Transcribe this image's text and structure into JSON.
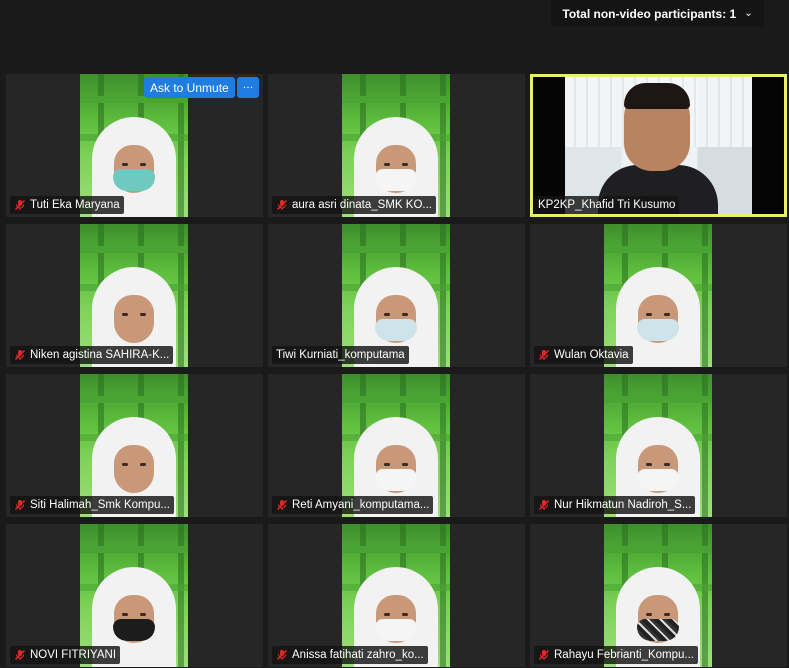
{
  "topbar": {
    "label": "Total non-video participants: 1"
  },
  "ask_to_unmute": "Ask to Unmute",
  "more_options": "···",
  "participants": [
    {
      "name": "Tuti Eka Maryana",
      "muted": true,
      "mask": "teal"
    },
    {
      "name": "aura asri dinata_SMK KO...",
      "muted": true,
      "mask": "white"
    },
    {
      "name": "KP2KP_Khafid Tri Kusumo",
      "muted": false,
      "host": true
    },
    {
      "name": "Niken agistina SAHIRA-K...",
      "muted": true,
      "mask": "none"
    },
    {
      "name": "Tiwi Kurniati_komputama",
      "muted": false,
      "mask": "blue"
    },
    {
      "name": "Wulan Oktavia",
      "muted": true,
      "mask": "blue"
    },
    {
      "name": "Siti Halimah_Smk Kompu...",
      "muted": true,
      "mask": "none"
    },
    {
      "name": "Reti Amyani_komputama...",
      "muted": true,
      "mask": "white"
    },
    {
      "name": "Nur Hikmatun Nadiroh_S...",
      "muted": true,
      "mask": "white"
    },
    {
      "name": "NOVI FITRIYANI",
      "muted": true,
      "mask": "black"
    },
    {
      "name": "Anissa fatihati zahro_ko...",
      "muted": true,
      "mask": "white"
    },
    {
      "name": "Rahayu Febrianti_Kompu...",
      "muted": true,
      "mask": "batik"
    }
  ],
  "colors": {
    "accent": "#1f7ce0",
    "active_speaker": "#e8ee6e",
    "muted_mic": "#e02828"
  }
}
